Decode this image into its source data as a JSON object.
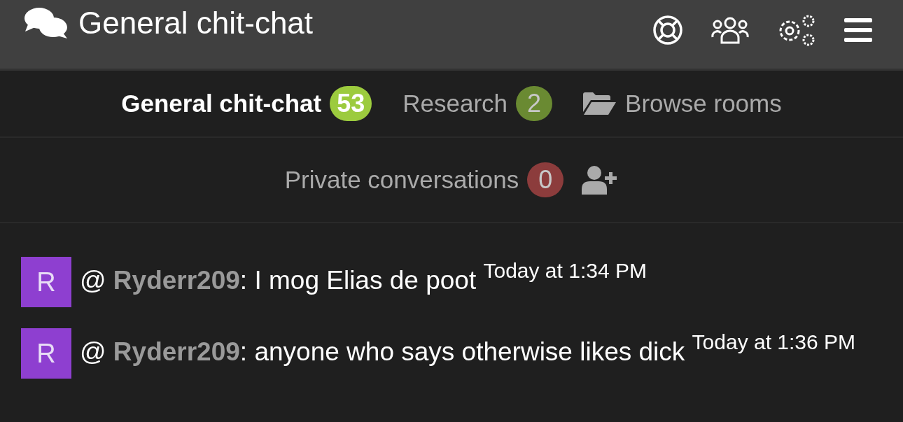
{
  "header": {
    "title": "General chit-chat"
  },
  "room_tabs": [
    {
      "kind": "room",
      "label": "General chit-chat",
      "count": "53",
      "color": "#9ccb3e",
      "selected": true
    },
    {
      "kind": "room",
      "label": "Research",
      "count": "2",
      "color": "#6a8a32",
      "selected": false
    },
    {
      "kind": "browse",
      "label": "Browse rooms"
    }
  ],
  "private": {
    "label": "Private conversations",
    "count": "0",
    "color": "#8c3c3c",
    "selected": false
  },
  "messages": [
    {
      "avatar": "R",
      "text": "@ **Ryderr209**: I mog Elias de poot",
      "time": "Today at 1:34 PM"
    },
    {
      "avatar": "R",
      "text": "@ **Ryderr209**: anyone who says otherwise likes dick",
      "time": "Today at 1:36 PM"
    }
  ]
}
